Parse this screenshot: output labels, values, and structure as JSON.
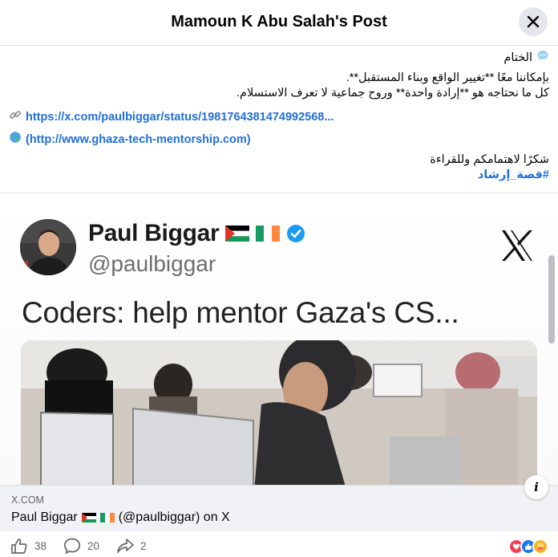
{
  "header": {
    "title": "Mamoun K Abu Salah's Post"
  },
  "post": {
    "closing_label": "الختام",
    "line1": "بإمكاننا معًا **تغيير الواقع وبناء المستقبل**.",
    "line2": "كل ما نحتاجه هو **إرادة واحدة** وروح جماعية لا تعرف الاستسلام.",
    "link1": "https://x.com/paulbiggar/status/1981764381474992568...",
    "link2": "(http://www.ghaza-tech-mentorship.com)",
    "thanks": "شكرًا لاهتمامكم وللقراءة",
    "hashtag": "#قصة_إرشاد"
  },
  "tweet": {
    "author_name": "Paul Biggar",
    "author_handle": "@paulbiggar",
    "text": "Coders: help mentor Gaza's CS..."
  },
  "preview": {
    "domain": "X.COM",
    "title_before": "Paul Biggar",
    "title_after": "(@paulbiggar) on X",
    "info_label": "i"
  },
  "actions": {
    "likes": "38",
    "comments": "20",
    "shares": "2"
  },
  "colors": {
    "accent": "#216fdb",
    "footer_bg": "#f0f2f5",
    "like_blue": "#1877f2",
    "love_red": "#f33e58",
    "care_yellow": "#f7b125"
  },
  "icons": [
    "close-icon",
    "speech-bubble-icon",
    "link-icon",
    "globe-icon",
    "verified-badge-icon",
    "x-logo-icon",
    "info-icon",
    "like-icon",
    "comment-icon",
    "share-icon",
    "love-reaction-icon",
    "like-reaction-icon",
    "care-reaction-icon"
  ]
}
